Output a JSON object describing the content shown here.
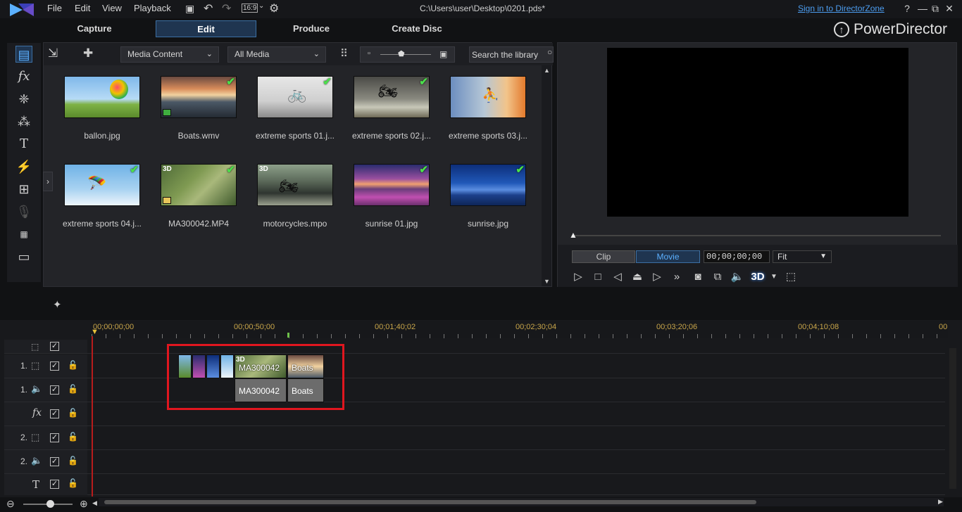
{
  "menu": {
    "file": "File",
    "edit": "Edit",
    "view": "View",
    "playback": "Playback",
    "aspect": "16:9"
  },
  "window": {
    "file_title": "C:\\Users\\user\\Desktop\\0201.pds*",
    "signin": "Sign in to DirectorZone",
    "help": "?"
  },
  "tabs": {
    "capture": "Capture",
    "edit": "Edit",
    "produce": "Produce",
    "create_disc": "Create Disc"
  },
  "brand": "PowerDirector",
  "library": {
    "content_dropdown": "Media Content",
    "filter_dropdown": "All Media",
    "search_placeholder": "Search the library",
    "items": [
      {
        "name": "ballon.jpg",
        "check": false,
        "badge3d": ""
      },
      {
        "name": "Boats.wmv",
        "check": true,
        "badge3d": ""
      },
      {
        "name": "extreme sports 01.j...",
        "check": true,
        "badge3d": ""
      },
      {
        "name": "extreme sports 02.j...",
        "check": true,
        "badge3d": ""
      },
      {
        "name": "extreme sports 03.j...",
        "check": false,
        "badge3d": ""
      },
      {
        "name": "extreme sports 04.j...",
        "check": true,
        "badge3d": ""
      },
      {
        "name": "MA300042.MP4",
        "check": true,
        "badge3d": "3D"
      },
      {
        "name": "motorcycles.mpo",
        "check": false,
        "badge3d": "3D"
      },
      {
        "name": "sunrise 01.jpg",
        "check": true,
        "badge3d": ""
      },
      {
        "name": "sunrise.jpg",
        "check": true,
        "badge3d": ""
      }
    ]
  },
  "preview": {
    "clip_label": "Clip",
    "movie_label": "Movie",
    "timecode": "00;00;00;00",
    "fit": "Fit",
    "threed": "3D"
  },
  "timeline": {
    "ruler": [
      "00;00;00;00",
      "00;00;50;00",
      "00;01;40;02",
      "00;02;30;04",
      "00;03;20;06",
      "00;04;10;08",
      "00"
    ],
    "tracks": [
      {
        "label": "",
        "type": "video-main"
      },
      {
        "label": "1.",
        "type": "video"
      },
      {
        "label": "1.",
        "type": "audio"
      },
      {
        "label": "",
        "type": "fx"
      },
      {
        "label": "2.",
        "type": "video"
      },
      {
        "label": "2.",
        "type": "audio"
      },
      {
        "label": "",
        "type": "title"
      }
    ],
    "clips": {
      "video_ma": "MA300042",
      "video_boats": "Boats",
      "audio_ma": "MA300042",
      "audio_boats": "Boats",
      "badge3d": "3D"
    }
  },
  "colors": {
    "accent": "#4c9df0",
    "selection_box": "#e0161f",
    "playhead": "#b71c1c",
    "ruler_text": "#c9a64a"
  }
}
